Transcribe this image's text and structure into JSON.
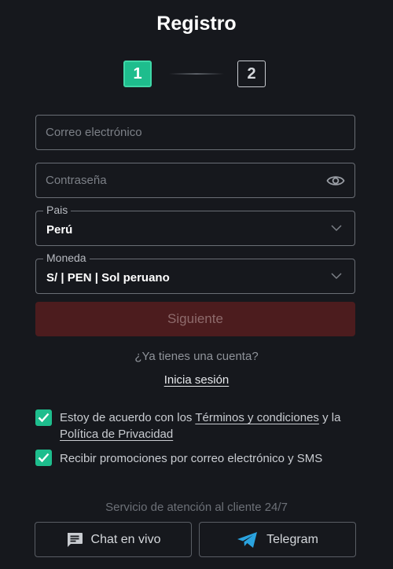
{
  "title": "Registro",
  "steps": [
    "1",
    "2"
  ],
  "form": {
    "email_placeholder": "Correo electrónico",
    "password_placeholder": "Contraseña",
    "country_label": "Pais",
    "country_value": "Perú",
    "currency_label": "Moneda",
    "currency_value": "S/ | PEN | Sol peruano",
    "submit_label": "Siguiente"
  },
  "login": {
    "question": "¿Ya tienes una cuenta?",
    "link": "Inicia sesión"
  },
  "consents": {
    "terms_prefix": "Estoy de acuerdo con los ",
    "terms_link": "Términos y condiciones",
    "terms_middle": " y la ",
    "privacy_link": "Política de Privacidad",
    "promo_text": "Recibir promociones por correo electrónico y SMS",
    "terms_checked": true,
    "promo_checked": true
  },
  "support": {
    "label": "Servicio de atención al cliente 24/7",
    "chat_label": "Chat en vivo",
    "telegram_label": "Telegram"
  },
  "colors": {
    "accent": "#1ebd8d",
    "background": "#16181d",
    "button_disabled": "#4c1c1e",
    "telegram": "#2aa3df"
  },
  "icons": [
    "eye-icon",
    "chevron-down-icon",
    "check-icon",
    "chat-icon",
    "telegram-icon"
  ]
}
